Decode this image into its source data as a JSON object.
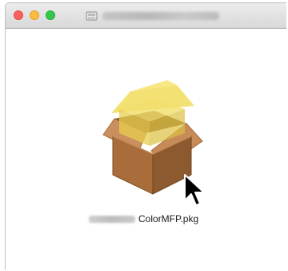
{
  "window": {
    "title": "",
    "traffic_lights": {
      "close_color": "#fc605c",
      "minimize_color": "#fdbc40",
      "zoom_color": "#34c84a"
    },
    "title_icon": "disk-icon"
  },
  "content": {
    "package": {
      "icon": "package-box-icon",
      "filename": "ColorMFP.pkg"
    },
    "cursor": "arrow-pointer-icon"
  }
}
